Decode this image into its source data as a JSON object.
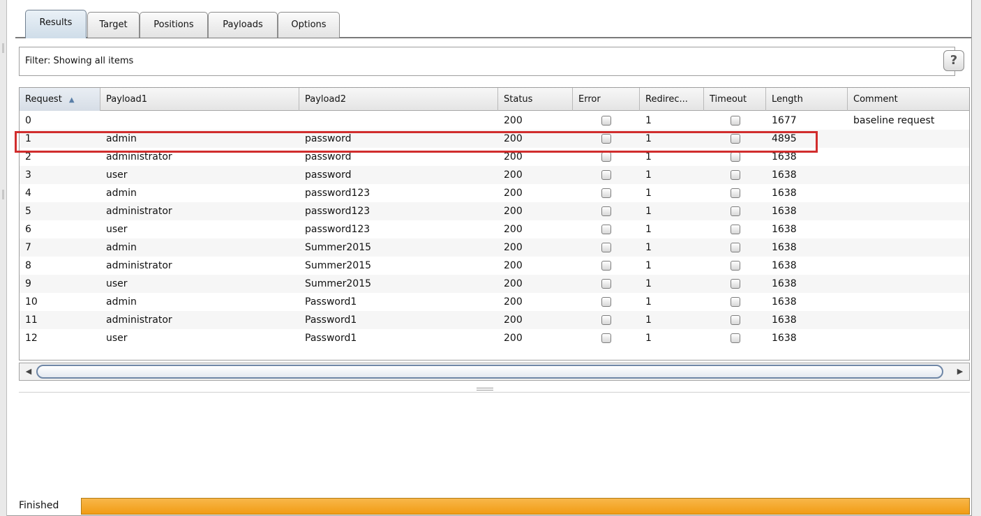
{
  "tabs": [
    "Results",
    "Target",
    "Positions",
    "Payloads",
    "Options"
  ],
  "filter": {
    "text": "Filter: Showing all items"
  },
  "help_label": "?",
  "columns": [
    "Request",
    "Payload1",
    "Payload2",
    "Status",
    "Error",
    "Redirec...",
    "Timeout",
    "Length",
    "Comment"
  ],
  "rows": [
    {
      "request": "0",
      "payload1": "",
      "payload2": "",
      "status": "200",
      "redirects": "1",
      "length": "1677",
      "comment": "baseline request"
    },
    {
      "request": "1",
      "payload1": "admin",
      "payload2": "password",
      "status": "200",
      "redirects": "1",
      "length": "4895",
      "comment": ""
    },
    {
      "request": "2",
      "payload1": "administrator",
      "payload2": "password",
      "status": "200",
      "redirects": "1",
      "length": "1638",
      "comment": ""
    },
    {
      "request": "3",
      "payload1": "user",
      "payload2": "password",
      "status": "200",
      "redirects": "1",
      "length": "1638",
      "comment": ""
    },
    {
      "request": "4",
      "payload1": "admin",
      "payload2": "password123",
      "status": "200",
      "redirects": "1",
      "length": "1638",
      "comment": ""
    },
    {
      "request": "5",
      "payload1": "administrator",
      "payload2": "password123",
      "status": "200",
      "redirects": "1",
      "length": "1638",
      "comment": ""
    },
    {
      "request": "6",
      "payload1": "user",
      "payload2": "password123",
      "status": "200",
      "redirects": "1",
      "length": "1638",
      "comment": ""
    },
    {
      "request": "7",
      "payload1": "admin",
      "payload2": "Summer2015",
      "status": "200",
      "redirects": "1",
      "length": "1638",
      "comment": ""
    },
    {
      "request": "8",
      "payload1": "administrator",
      "payload2": "Summer2015",
      "status": "200",
      "redirects": "1",
      "length": "1638",
      "comment": ""
    },
    {
      "request": "9",
      "payload1": "user",
      "payload2": "Summer2015",
      "status": "200",
      "redirects": "1",
      "length": "1638",
      "comment": ""
    },
    {
      "request": "10",
      "payload1": "admin",
      "payload2": "Password1",
      "status": "200",
      "redirects": "1",
      "length": "1638",
      "comment": ""
    },
    {
      "request": "11",
      "payload1": "administrator",
      "payload2": "Password1",
      "status": "200",
      "redirects": "1",
      "length": "1638",
      "comment": ""
    },
    {
      "request": "12",
      "payload1": "user",
      "payload2": "Password1",
      "status": "200",
      "redirects": "1",
      "length": "1638",
      "comment": ""
    }
  ],
  "status": {
    "label": "Finished",
    "progress": 1.0
  },
  "colors": {
    "progress": "#f19c14",
    "highlight": "#d12d2d",
    "scroll_thumb": "#6e86a6"
  }
}
